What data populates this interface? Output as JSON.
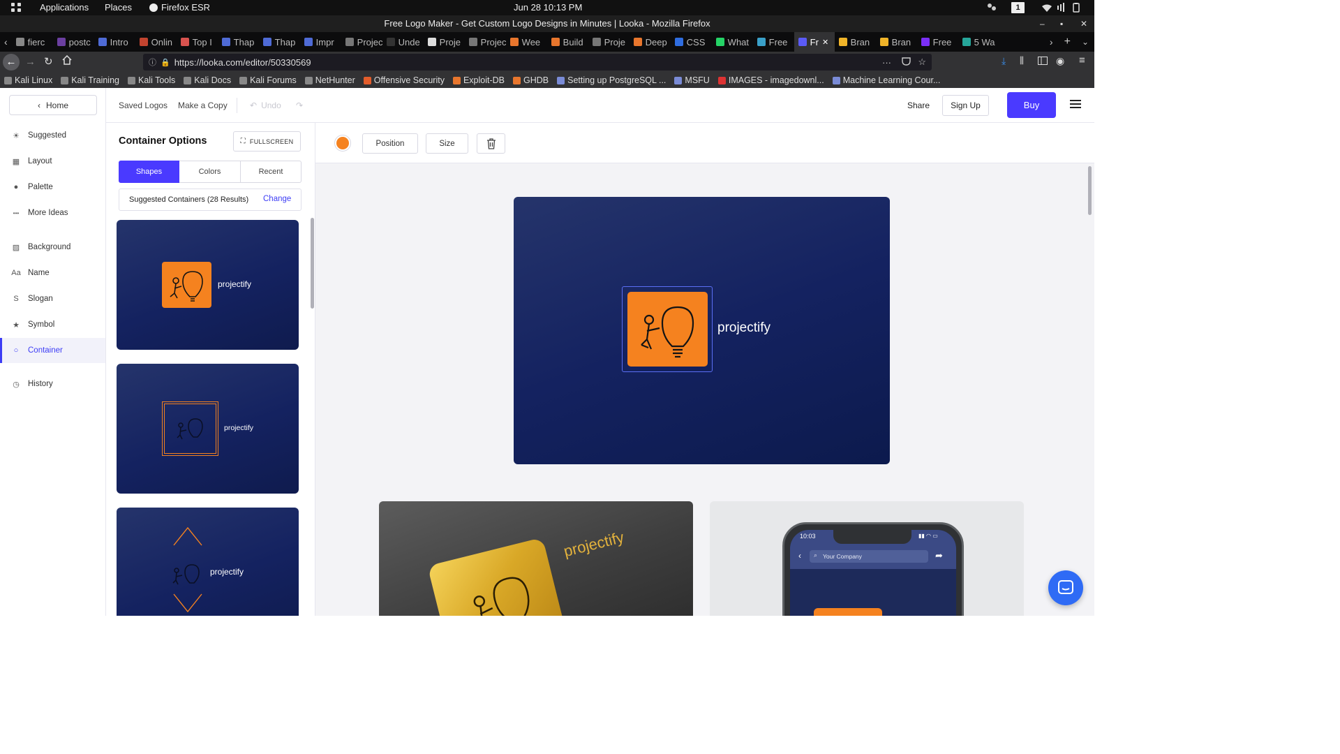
{
  "system": {
    "applications": "Applications",
    "places": "Places",
    "browser_name": "Firefox ESR",
    "datetime": "Jun 28  10:13 PM",
    "workspace": "1"
  },
  "window": {
    "title": "Free Logo Maker - Get Custom Logo Designs in Minutes | Looka - Mozilla Firefox"
  },
  "tabs": [
    {
      "label": "fierc",
      "color": "#888"
    },
    {
      "label": "postc",
      "color": "#6b3fa0"
    },
    {
      "label": "Intro",
      "color": "#4f6bd6"
    },
    {
      "label": "Onlin",
      "color": "#c2442f"
    },
    {
      "label": "Top I",
      "color": "#d9534f"
    },
    {
      "label": "Thap",
      "color": "#4f6bd6"
    },
    {
      "label": "Thap",
      "color": "#4f6bd6"
    },
    {
      "label": "Impr",
      "color": "#4f6bd6"
    },
    {
      "label": "Projectif",
      "color": "#777"
    },
    {
      "label": "Unde",
      "color": "#333"
    },
    {
      "label": "Proje",
      "color": "#ddd"
    },
    {
      "label": "Projectif",
      "color": "#777"
    },
    {
      "label": "Wee",
      "color": "#e8762d"
    },
    {
      "label": "Build",
      "color": "#e8762d"
    },
    {
      "label": "Proje",
      "color": "#777"
    },
    {
      "label": "Deep",
      "color": "#e8762d"
    },
    {
      "label": "CSS",
      "color": "#2f6de0"
    },
    {
      "label": "What",
      "color": "#25d366"
    },
    {
      "label": "Free",
      "color": "#3aa0c8"
    },
    {
      "label": "Fr",
      "color": "#5b5bf7"
    },
    {
      "label": "Bran",
      "color": "#f0b429"
    },
    {
      "label": "Bran",
      "color": "#f0b429"
    },
    {
      "label": "Free",
      "color": "#7b2ff7"
    },
    {
      "label": "5 Wa",
      "color": "#26a69a"
    }
  ],
  "url": "https://looka.com/editor/50330569",
  "bookmarks": [
    "Kali Linux",
    "Kali Training",
    "Kali Tools",
    "Kali Docs",
    "Kali Forums",
    "NetHunter",
    "Offensive Security",
    "Exploit-DB",
    "GHDB",
    "Setting up PostgreSQL ...",
    "MSFU",
    "IMAGES - imagedownl...",
    "Machine Learning Cour..."
  ],
  "leftnav": {
    "home": "Home",
    "items": [
      {
        "label": "Suggested",
        "icon": "sun-icon"
      },
      {
        "label": "Layout",
        "icon": "layout-icon"
      },
      {
        "label": "Palette",
        "icon": "drop-icon"
      },
      {
        "label": "More Ideas",
        "icon": "dots-icon"
      },
      {
        "label": "Background",
        "icon": "background-icon"
      },
      {
        "label": "Name",
        "icon": "text-icon"
      },
      {
        "label": "Slogan",
        "icon": "slogan-icon"
      },
      {
        "label": "Symbol",
        "icon": "star-icon"
      },
      {
        "label": "Container",
        "icon": "circle-icon",
        "active": true
      },
      {
        "label": "History",
        "icon": "clock-icon"
      }
    ]
  },
  "toolbar": {
    "saved_logos": "Saved Logos",
    "make_copy": "Make a Copy",
    "undo": "Undo",
    "share": "Share",
    "sign_up": "Sign Up",
    "buy": "Buy"
  },
  "panel": {
    "title": "Container Options",
    "fullscreen": "FULLSCREEN",
    "tabs": [
      "Shapes",
      "Colors",
      "Recent"
    ],
    "suggested": "Suggested Containers (28 Results)",
    "change": "Change",
    "brand": "projectify"
  },
  "canvas": {
    "position": "Position",
    "size": "Size",
    "brand": "projectify",
    "accent": "#f5821f",
    "mock_time": "10:03",
    "mock_search": "Your Company"
  },
  "colors": {
    "primary": "#4a3aff",
    "navy": "#142260",
    "orange": "#f5821f"
  }
}
